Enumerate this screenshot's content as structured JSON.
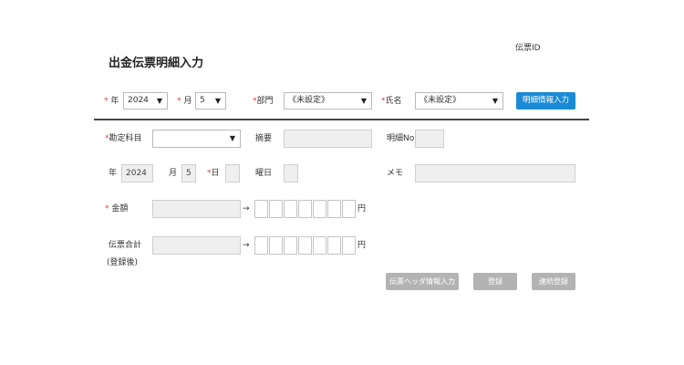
{
  "header": {
    "title": "出金伝票明細入力",
    "slip_id_label": "伝票ID"
  },
  "filters": {
    "year_label": "年",
    "year_value": "2024",
    "month_label": "月",
    "month_value": "5",
    "dept_label": "部門",
    "dept_value": "《未設定》",
    "name_label": "氏名",
    "name_value": "《未設定》",
    "detail_button": "明細情報入力"
  },
  "form": {
    "account_label": "勘定科目",
    "account_value": "",
    "summary_label": "摘要",
    "summary_value": "",
    "detail_no_label": "明細No",
    "detail_no_value": "",
    "year_label": "年",
    "year_value": "2024",
    "month_label": "月",
    "month_value": "5",
    "day_label": "日",
    "day_value": "",
    "weekday_label": "曜日",
    "weekday_value": "",
    "memo_label": "メモ",
    "memo_value": "",
    "amount_label": "金額",
    "arrow": "→",
    "yen": "円",
    "total_label": "伝票合計",
    "total_sub_label": "(登録後)"
  },
  "actions": {
    "header_info_button": "伝票ヘッダ情報入力",
    "register_button": "登録",
    "continuous_button": "連続登録"
  }
}
